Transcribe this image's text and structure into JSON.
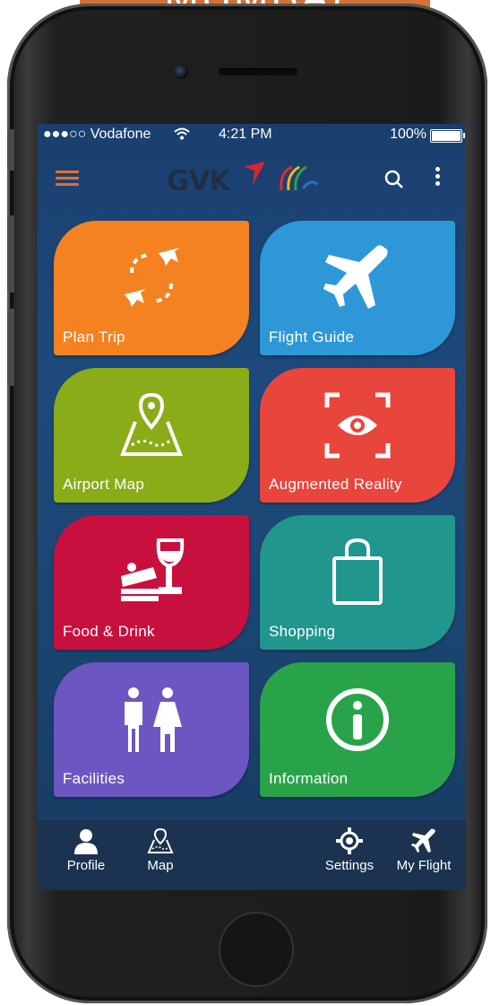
{
  "banner": {
    "text": "MUMBAI"
  },
  "statusbar": {
    "carrier": "●●●○○ Vodafone",
    "time": "4:21 PM",
    "battery": "100%"
  },
  "header": {
    "logo_text": "GVK"
  },
  "tiles": [
    {
      "label": "Plan Trip",
      "color": "#f58220",
      "icon": "plan-trip-icon"
    },
    {
      "label": "Flight Guide",
      "color": "#2e97d8",
      "icon": "airplane-icon"
    },
    {
      "label": "Airport Map",
      "color": "#8aac19",
      "icon": "map-pin-icon"
    },
    {
      "label": "Augmented Reality",
      "color": "#e8453d",
      "icon": "eye-scan-icon"
    },
    {
      "label": "Food & Drink",
      "color": "#c8103e",
      "icon": "food-drink-icon"
    },
    {
      "label": "Shopping",
      "color": "#21968c",
      "icon": "shopping-bag-icon"
    },
    {
      "label": "Facilities",
      "color": "#6c57c2",
      "icon": "restroom-icon"
    },
    {
      "label": "Information",
      "color": "#29a34a",
      "icon": "info-icon"
    }
  ],
  "bottomnav": {
    "profile": "Profile",
    "map": "Map",
    "settings": "Settings",
    "myflight": "My Flight"
  },
  "colors": {
    "accent": "#e86f2c",
    "background": "#1d4a7d"
  }
}
